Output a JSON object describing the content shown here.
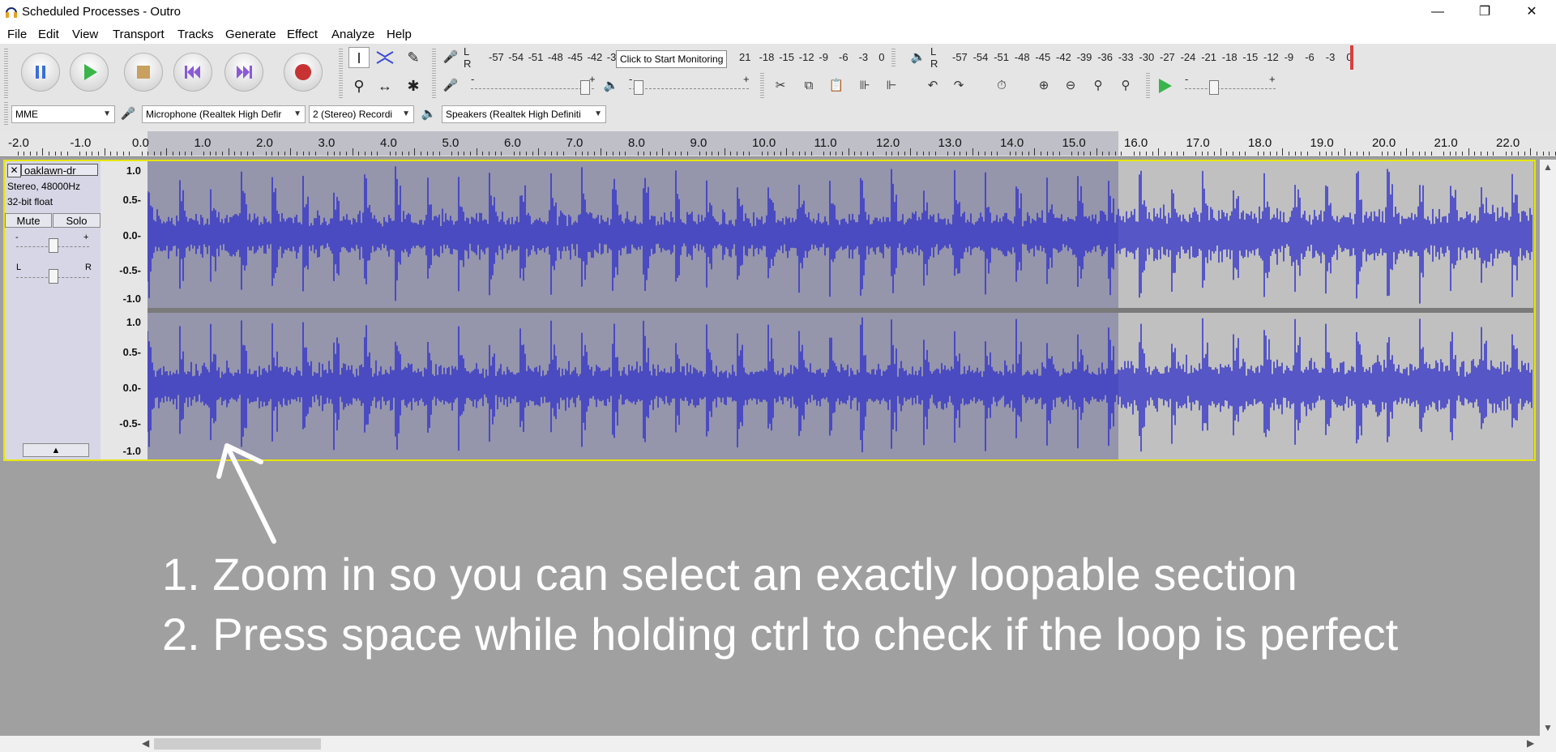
{
  "window": {
    "title": "Scheduled Processes - Outro",
    "controls": {
      "minimize": "—",
      "maximize": "❐",
      "close": "✕"
    }
  },
  "menu": [
    "File",
    "Edit",
    "View",
    "Transport",
    "Tracks",
    "Generate",
    "Effect",
    "Analyze",
    "Help"
  ],
  "record_meter": {
    "ticks": [
      "-57",
      "-54",
      "-51",
      "-48",
      "-45",
      "-42",
      "-3",
      "21",
      "-18",
      "-15",
      "-12",
      "-9",
      "-6",
      "-3",
      "0"
    ],
    "tooltip": "Click to Start Monitoring",
    "lr": [
      "L",
      "R"
    ]
  },
  "playback_meter": {
    "ticks": [
      "-57",
      "-54",
      "-51",
      "-48",
      "-45",
      "-42",
      "-39",
      "-36",
      "-33",
      "-30",
      "-27",
      "-24",
      "-21",
      "-18",
      "-15",
      "-12",
      "-9",
      "-6",
      "-3",
      "0"
    ],
    "lr": [
      "L",
      "R"
    ]
  },
  "slider_signs": {
    "minus": "-",
    "plus": "+"
  },
  "device_toolbar": {
    "host": "MME",
    "input_device": "Microphone (Realtek High Defir",
    "channels": "2 (Stereo) Recordi",
    "output_device": "Speakers (Realtek High Definiti"
  },
  "ruler": {
    "ticks": [
      "-2.0",
      "-1.0",
      "0.0",
      "1.0",
      "2.0",
      "3.0",
      "4.0",
      "5.0",
      "6.0",
      "7.0",
      "8.0",
      "9.0",
      "10.0",
      "11.0",
      "12.0",
      "13.0",
      "14.0",
      "15.0",
      "16.0",
      "17.0",
      "18.0",
      "19.0",
      "20.0",
      "21.0",
      "22.0"
    ],
    "selection_seconds": [
      0.0,
      15.95
    ]
  },
  "track": {
    "name": "oaklawn-dr",
    "format_line1": "Stereo, 48000Hz",
    "format_line2": "32-bit float",
    "mute_label": "Mute",
    "solo_label": "Solo",
    "gain_signs": [
      "-",
      "+"
    ],
    "pan_signs": [
      "L",
      "R"
    ],
    "vruler_labels": [
      "1.0",
      "0.5-",
      "0.0-",
      "-0.5-",
      "-1.0"
    ],
    "wave_color": "#3232c8"
  },
  "instructions": [
    "1. Zoom in so you can select an exactly loopable section",
    "2. Press space while holding ctrl to check if the loop is perfect"
  ]
}
